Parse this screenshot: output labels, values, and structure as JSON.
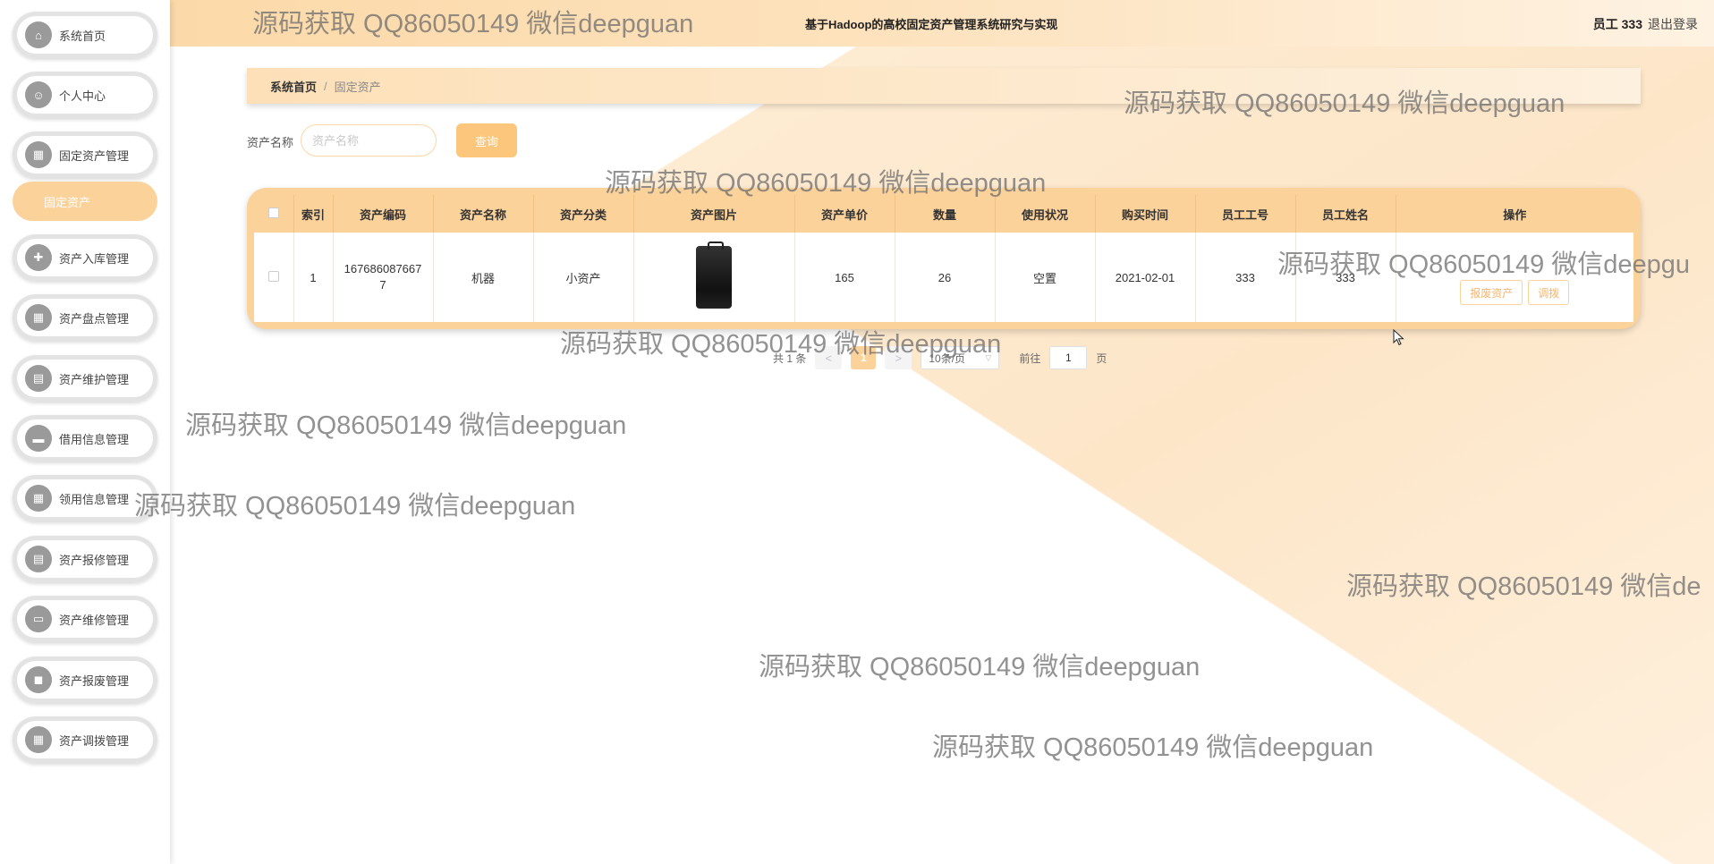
{
  "header": {
    "title": "基于Hadoop的高校固定资产管理系统研究与实现",
    "user": "员工 333",
    "logout": "退出登录"
  },
  "sidebar": {
    "items": [
      {
        "label": "系统首页",
        "icon": "home-icon"
      },
      {
        "label": "个人中心",
        "icon": "user-icon"
      },
      {
        "label": "固定资产管理",
        "icon": "grid-icon"
      },
      {
        "label": "资产入库管理",
        "icon": "inbound-icon"
      },
      {
        "label": "资产盘点管理",
        "icon": "grid-icon"
      },
      {
        "label": "资产维护管理",
        "icon": "clipboard-icon"
      },
      {
        "label": "借用信息管理",
        "icon": "ticket-icon"
      },
      {
        "label": "领用信息管理",
        "icon": "grid-icon"
      },
      {
        "label": "资产报修管理",
        "icon": "clipboard-icon"
      },
      {
        "label": "资产维修管理",
        "icon": "monitor-icon"
      },
      {
        "label": "资产报废管理",
        "icon": "chat-icon"
      },
      {
        "label": "资产调拨管理",
        "icon": "grid-icon"
      }
    ],
    "submenu": "固定资产"
  },
  "breadcrumb": {
    "home": "系统首页",
    "sep": "/",
    "current": "固定资产"
  },
  "search": {
    "label": "资产名称",
    "placeholder": "资产名称",
    "button": "查询"
  },
  "table": {
    "headers": [
      "索引",
      "资产编码",
      "资产名称",
      "资产分类",
      "资产图片",
      "资产单价",
      "数量",
      "使用状况",
      "购买时间",
      "员工工号",
      "员工姓名",
      "操作"
    ],
    "rows": [
      {
        "index": "1",
        "code": "1676860876677",
        "name": "机器",
        "category": "小资产",
        "price": "165",
        "qty": "26",
        "status": "空置",
        "date": "2021-02-01",
        "emp_no": "333",
        "emp_name": "333"
      }
    ],
    "ops": {
      "scrap": "报废资产",
      "transfer": "调拨"
    }
  },
  "pager": {
    "total": "共 1 条",
    "prev": "<",
    "page": "1",
    "next": ">",
    "size": "10条/页",
    "goto": "前往",
    "goto_value": "1",
    "page_unit": "页"
  },
  "watermark": {
    "text": "源码获取 QQ86050149 微信deepguan",
    "cut1": "源码获取 QQ86050149 微信deepgu",
    "cut2": "源码获取 QQ86050149 微信de"
  },
  "colors": {
    "accent": "#fcd29b",
    "button": "#fcc67c"
  }
}
